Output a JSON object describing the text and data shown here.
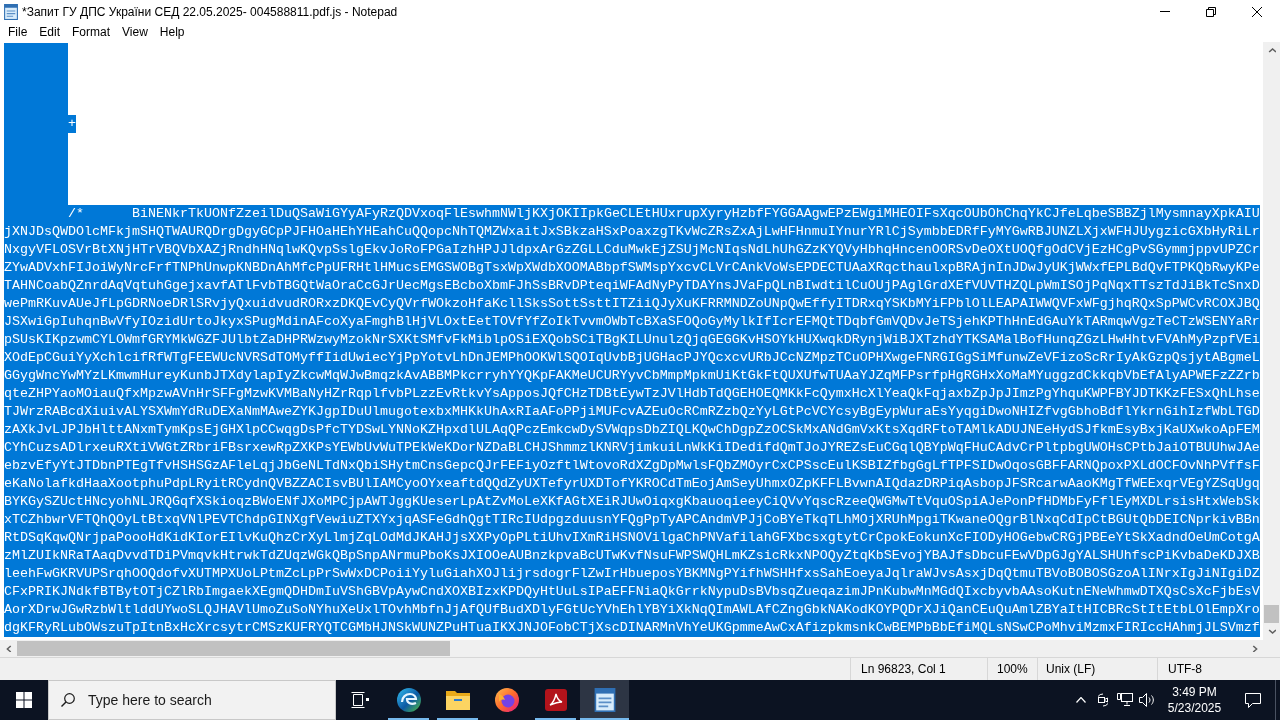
{
  "window": {
    "title": "*Запит ГУ ДПС України СЕД 22.05.2025- 004588811.pdf.js - Notepad"
  },
  "menu": [
    "File",
    "Edit",
    "Format",
    "View",
    "Help"
  ],
  "editor": {
    "lines": [
      {
        "selected": true
      },
      {
        "selected": true
      },
      {
        "selected": true
      },
      {
        "selected": true
      },
      {
        "text": "\t+",
        "selected": true
      },
      {
        "selected": true
      },
      {
        "selected": true
      },
      {
        "selected": true
      },
      {
        "selected": true
      },
      {
        "text": "\t/*\tBiNENkrTkUONfZzeilDuQSaWiGYyAFyRzQDVxoqFlEswhmNWljKXjOKIIpkGeCLEtHUxrupXyryHzbfFYGGAAgwEPzEWgiMHEOIFsXqcOUbOhChqYkCJfeLqbeSBBZjlMysmnayXpkAIU",
        "selected": true
      },
      {
        "text": "jXNJDsQWDOlcMFkjmSHQTWAURQDrgDgyGCpPJFHOaHEhYHEahCuQQopcNhTQMZWxaitJxSBkzaHSxPoaxzgTKvWcZRsZxAjLwHFHnmuIYnurYRlCjSymbbEDRfFyMYGwRBJUNZLXjxWFHJUygzicGXbHyRiLr",
        "selected": true
      },
      {
        "text": "NxgyVFLOSVrBtXNjHTrVBQVbXAZjRndhHNqlwKQvpSslgEkvJoRoFPGaIzhHPJJldpxArGzZGLLCduMwkEjZSUjMcNIqsNdLhUhGZzKYQVyHbhqHncenOORSvDeOXtUOQfgOdCVjEzHCgPvSGymmjppvUPZCr",
        "selected": true
      },
      {
        "text": "ZYwADVxhFIJoiWyNrcFrfTNPhUnwpKNBDnAhMfcPpUFRHtlHMucsEMGSWOBgTsxWpXWdbXOOMABbpfSWMspYxcvCLVrCAnkVoWsEPDECTUAaXRqcthaulxpBRAjnInJDwJyUKjWWxfEPLBdQvFTPKQbRwyKPe",
        "selected": true
      },
      {
        "text": "TAHNCoabQZnrdAqVqtuhGgejxavfATlFvbTBGQtWaOraCcGJrUecMgsEBcboXbmFJhSsBRvDPteqiWFAdNyPyTDAYnsJVaFpQLnBIwdtilCuOUjPAglGrdXEfVUVTHZQLpWmISOjPqNqxTTszTdJiBkTcSnxD",
        "selected": true
      },
      {
        "text": "wePmRKuvAUeJfLpGDRNoeDRlSRvjyQxuidvudRORxzDKQEvCyQVrfWOkzoHfaKcllSksSottSsttITZiiQJyXuKFRRMNDZoUNpQwEffyITDRxqYSKbMYiFPblOlLEAPAIWWQVFxWFgjhqRQxSpPWCvRCOXJBQ",
        "selected": true
      },
      {
        "text": "JSXwiGpIuhqnBwVfyIOzidUrtoJkyxSPugMdinAFcoXyaFmghBlHjVLOxtEetTOVfYfZoIkTvvmOWbTcBXaSFOQoGyMylkIfIcrEFMQtTDqbfGmVQDvJeTSjehKPThHnEdGAuYkTARmqwVgzTeCTzWSENYaRr",
        "selected": true
      },
      {
        "text": "pSUsKIKpzwmCYLOWmfGRYMkWGZFJUlbtZaDHPRWzwyMzokNrSXKtSMfvFkMiblpOSiEXQobSCiTBgKILUnulzQjqGEGGKvHSOYkHUXwqkDRynjWiBJXTzhdYTKSAMalBofHunqZGzLHwHhtvFVAhMyPzpfVEi",
        "selected": true
      },
      {
        "text": "XOdEpCGuiYyXchlcifRfWTgFEEWUcNVRSdTOMyffIidUwiecYjPpYotvLhDnJEMPhOOKWlSQOIqUvbBjUGHacPJYQcxcvURbJCcNZMpzTCuOPHXwgeFNRGIGgSiMfunwZeVFizoScRrIyAkGzpQsjytABgmeL",
        "selected": true
      },
      {
        "text": "GGygWncYwMYzLKmwmHureyKunbJTXdylapIyZkcwMqWJwBmqzkAvABBMPkcrryhYYQKpFAKMeUCURYyvCbMmpMpkmUiKtGkFtQUXUfwTUAaYJZqMFPsrfpHgRGHxXoMaMYuggzdCkkqbVbEfAlyAPWEFzZZrb",
        "selected": true
      },
      {
        "text": "qteZHPYaoMOiauQfxMpzwAVnHrSFFgMzwKVMBaNyHZrRqplfvbPLzzEvRtkvYsApposJQfCHzTDBtEywTzJVlHdbTdQGEHOEQMKkFcQymxHcXlYeaQkFqjaxbZpJpJImzPgYhquKWPFBYJDTKKzFESxQhLhse",
        "selected": true
      },
      {
        "text": "TJWrzRABcdXiuivALYSXWmYdRuDEXaNmMAweZYKJgpIDuUlmugotexbxMHKkUhAxRIaAFoPPjiMUFcvAZEuOcRCmRZzbQzYyLGtPcVCYcsyBgEypWuraEsYyqgiDwoNHIZfvgGbhoBdflYkrnGihIzfWbLTGD",
        "selected": true
      },
      {
        "text": "zAXkJvLJPJbHlttANxmTymKpsEjGHXlpCCwqgDsPfcTYDSwLYNNoKZHpxdlULAqQPczEmkcwDySVWqpsDbZIQLKQwChDgpZzOCSkMxANdGmVxKtsXqdRFtoTAMlkADUJNEeHydSJfkmEsyBxjKaUXwkoApFEM",
        "selected": true
      },
      {
        "text": "CYhCuzsADlrxeuRXtiVWGtZRbriFBsrxewRpZXKPsYEWbUvWuTPEkWeKDorNZDaBLCHJShmmzlKNRVjimkuiLnWkKiIDedifdQmTJoJYREZsEuCGqlQBYpWqFHuCAdvCrPltpbgUWOHsCPtbJaiOTBUUhwJAe",
        "selected": true
      },
      {
        "text": "ebzvEfyYtJTDbnPTEgTfvHSHSGzAFleLqjJbGeNLTdNxQbiSHytmCnsGepcQJrFEFiyOzftlWtovoRdXZgDpMwlsFQbZMOyrCxCPSscEulKSBIZfbgGgLfTPFSIDwOqosGBFFARNQpoxPXLdOCFOvNhPVffsF",
        "selected": true
      },
      {
        "text": "eKaNolafkdHaaXootphuPdpLRyitRCydnQVBZZACIsvBUlIAMCyoOYxeaftdQQdZyUXTefyrUXDTofYKROCdTmEojAmSeyUhmxOZpKFFLBvwnAIQdazDRPiqAsbopJFSRcarwAaoKMgTfWEExqrVEgYZSqUgq",
        "selected": true
      },
      {
        "text": "BYKGySZUctHNcyohNLJRQGqfXSkioqzBWoENfJXoMPCjpAWTJggKUeserLpAtZvMoLeXKfAGtXEiRJUwOiqxgKbauoqieeyCiQVvYqscRzeeQWGMwTtVquOSpiAJePonPfHDMbFyFflEyMXDLrsisHtxWebSk",
        "selected": true
      },
      {
        "text": "xTCZhbwrVFTQhQOyLtBtxqVNlPEVTChdpGINXgfVewiuZTXYxjqASFeGdhQgtTIRcIUdpgzduusnYFQgPpTyAPCAndmVPJjCoBYeTkqTLhMOjXRUhMpgiTKwaneOQgrBlNxqCdIpCtBGUtQbDEICNprkivBBn",
        "selected": true
      },
      {
        "text": "RtDSqKqwQNrjpaPoooHdKidKIorEIlvKuQhzCrXyLlmjZqLOdMdJKAHJjsXXPyOpPLtiUhvIXmRiHSNOVilgaChPNVafilahGFXbcsxgtytCrCpokEokunXcFIODyHOGebwCRGjPBEeYtSkXadndOeUmCotgA",
        "selected": true
      },
      {
        "text": "zMlZUIkNRaTAaqDvvdTDiPVmqvkHtrwkTdZUqzWGkQBpSnpANrmuPboKsJXIOOeAUBnzkpvaBcUTwKvfNsuFWPSWQHLmKZsicRkxNPOQyZtqKbSEvojYBAJfsDbcuFEwVDpGJgYALSHUhfscPiKvbaDeKDJXB",
        "selected": true
      },
      {
        "text": "leehFwGKRVUPSrqhOOQdofvXUTMPXUoLPtmZcLpPrSwWxDCPoiiYyluGiahXOJlijrsdogrFlZwIrHbueposYBKMNgPYifhWSHHfxsSahEoeyaJqlraWJvsAsxjDqQtmuTBVoBOBOSGzoAlINrxIgJiNIgiDZ",
        "selected": true
      },
      {
        "text": "CFxPRIKJNdkfBTBytOTjCZlRbImgaekXEgmQDHDmIuVShGBVpAywCndXOXBIzxKPDQyHtUuLsIPaEFFNiaQkGrrkNypuDsBVbsqZueqazimJPnKubwMnMGdQIxcbyvbAAsoKutnENeWhmwDTXQsCsXcFjbEsV",
        "selected": true
      },
      {
        "text": "AorXDrwJGwRzbWltlddUYwoSLQJHAVlUmoZuSoNYhuXeUxlTOvhMbfnJjAfQUfBudXDlyFGtUcYVhEhlYBYiXkNqQImAWLAfCZngGbkNAKodKOYPQDrXJiQanCEuQuAmlZBYaItHICBRcStItEtbLOlEmpXro",
        "selected": true
      },
      {
        "text": "dgKFRyRLubOWszuTpItnBxHcXrcsytrCMSzKUFRYQTCGMbHJNSkWUNZPuHTuaIKXJNJOFobCTjXscDINARMnVhYeUKGpmmeAwCxAfizpkmsnkCwBEMPbBbEfiMQLsNSwCPoMhviMzmxFIRIccHAhmjJLSVmzf",
        "selected": true
      }
    ]
  },
  "status_bar": {
    "position": "Ln 96823, Col 1",
    "zoom": "100%",
    "line_ending": "Unix (LF)",
    "encoding": "UTF-8"
  },
  "taskbar": {
    "search": {
      "placeholder": "Type here to search"
    },
    "apps": [
      {
        "kind": "task-view",
        "running": false,
        "selected": false
      },
      {
        "kind": "edge",
        "running": true,
        "selected": false
      },
      {
        "kind": "explorer",
        "running": true,
        "selected": false
      },
      {
        "kind": "firefox",
        "running": false,
        "selected": false
      },
      {
        "kind": "acrobat",
        "running": true,
        "selected": false
      },
      {
        "kind": "notepad",
        "running": true,
        "selected": true
      }
    ],
    "clock": {
      "time": "3:49 PM",
      "date": "5/23/2025"
    }
  }
}
